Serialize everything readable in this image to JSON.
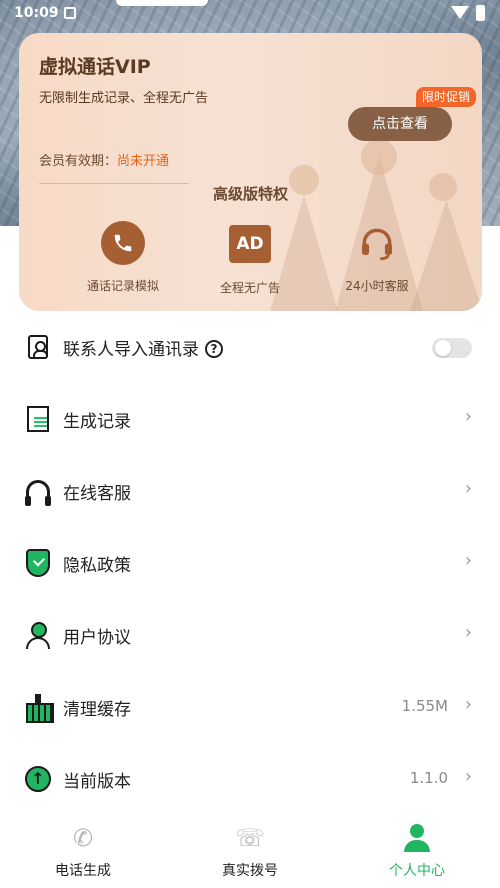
{
  "status_bar": {
    "time": "10:09"
  },
  "vip": {
    "title": "虚拟通话VIP",
    "desc": "无限制生成记录、全程无广告",
    "validity_label": "会员有效期：",
    "validity_value": "尚未开通",
    "promo_badge": "限时促销",
    "view_button": "点击查看",
    "perks_title": "高级版特权",
    "perks": [
      {
        "label": "通话记录模拟",
        "icon": "phone-icon"
      },
      {
        "label": "全程无广告",
        "icon": "ad-icon",
        "icon_text": "AD"
      },
      {
        "label": "24小时客服",
        "icon": "headset-icon"
      }
    ]
  },
  "menu": {
    "items": [
      {
        "label": "联系人导入通讯录",
        "icon": "contacts-icon",
        "help": "?",
        "toggle_on": false
      },
      {
        "label": "生成记录",
        "icon": "record-icon",
        "chevron": "›"
      },
      {
        "label": "在线客服",
        "icon": "headset-icon",
        "chevron": "›"
      },
      {
        "label": "隐私政策",
        "icon": "shield-icon",
        "chevron": "›"
      },
      {
        "label": "用户协议",
        "icon": "user-icon",
        "chevron": "›"
      },
      {
        "label": "清理缓存",
        "icon": "broom-icon",
        "value": "1.55M",
        "chevron": "›"
      },
      {
        "label": "当前版本",
        "icon": "upgrade-icon",
        "icon_text": "↑",
        "value": "1.1.0",
        "chevron": "›"
      }
    ]
  },
  "bottom_nav": {
    "tabs": [
      {
        "label": "电话生成",
        "icon": "phone-icon",
        "icon_text": "✆"
      },
      {
        "label": "真实拨号",
        "icon": "dialpad-icon",
        "icon_text": "☏"
      },
      {
        "label": "个人中心",
        "icon": "person-icon",
        "active": true
      }
    ]
  },
  "colors": {
    "accent": "#22b561",
    "promo": "#f2662a",
    "vip_brown": "#876046"
  }
}
